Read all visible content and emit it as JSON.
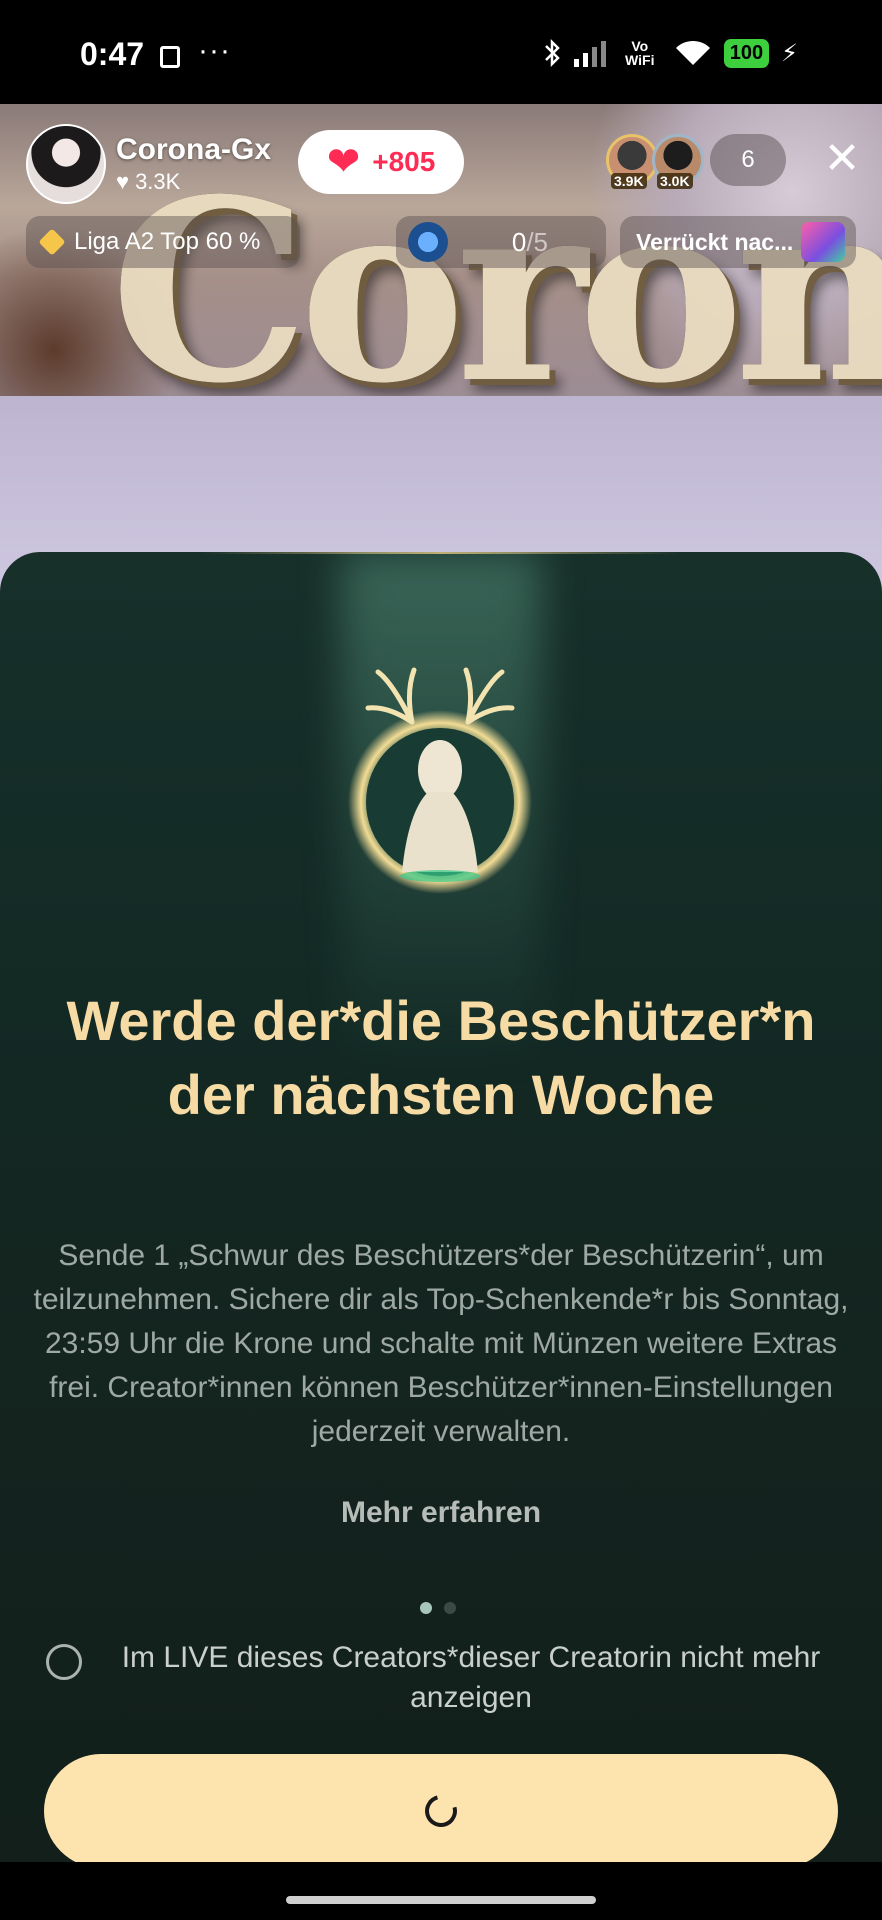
{
  "status_bar": {
    "time": "0:47",
    "dots": "···",
    "network_label": "Vo WiFi",
    "battery": "100"
  },
  "live": {
    "host_name": "Corona-Gx",
    "host_likes": "3.3K",
    "like_count": "+805",
    "viewers": [
      {
        "count": "3.9K"
      },
      {
        "count": "3.0K"
      }
    ],
    "viewer_total": "6",
    "league_label": "Liga A2 Top 60 %",
    "goal_progress": "0",
    "goal_total": "/5",
    "event_label": "Verrückt nac..."
  },
  "sheet": {
    "title": "Werde der*die Beschützer*n der nächsten Woche",
    "description": "Sende 1 „Schwur des Beschützers*der Beschützerin“, um teilzunehmen. Sichere dir als Top-Schenkende*r bis Sonntag, 23:59 Uhr die Krone und schalte mit Münzen weitere Extras frei. Creator*innen können Beschützer*innen-Einstellungen jederzeit verwalten.",
    "learn_more": "Mehr erfahren",
    "page_dots": {
      "count": 2,
      "active": 0
    },
    "dont_show_label": "Im LIVE dieses Creators*dieser Creatorin nicht mehr anzeigen",
    "dont_show_checked": false,
    "primary_button_state": "loading"
  },
  "colors": {
    "title_gold": "#f6dca4",
    "button_bg": "#fde4ae",
    "sheet_bg": "#14241f",
    "like_red": "#fe2c55"
  }
}
